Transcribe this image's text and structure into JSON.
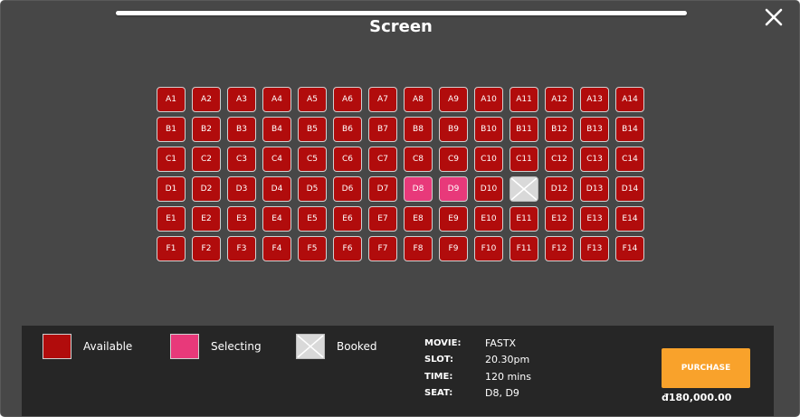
{
  "modal": {
    "screen_label": "Screen"
  },
  "seat_rows": [
    {
      "row": "A",
      "seats": [
        {
          "label": "A1",
          "status": "available"
        },
        {
          "label": "A2",
          "status": "available"
        },
        {
          "label": "A3",
          "status": "available"
        },
        {
          "label": "A4",
          "status": "available"
        },
        {
          "label": "A5",
          "status": "available"
        },
        {
          "label": "A6",
          "status": "available"
        },
        {
          "label": "A7",
          "status": "available"
        },
        {
          "label": "A8",
          "status": "available"
        },
        {
          "label": "A9",
          "status": "available"
        },
        {
          "label": "A10",
          "status": "available"
        },
        {
          "label": "A11",
          "status": "available"
        },
        {
          "label": "A12",
          "status": "available"
        },
        {
          "label": "A13",
          "status": "available"
        },
        {
          "label": "A14",
          "status": "available"
        }
      ]
    },
    {
      "row": "B",
      "seats": [
        {
          "label": "B1",
          "status": "available"
        },
        {
          "label": "B2",
          "status": "available"
        },
        {
          "label": "B3",
          "status": "available"
        },
        {
          "label": "B4",
          "status": "available"
        },
        {
          "label": "B5",
          "status": "available"
        },
        {
          "label": "B6",
          "status": "available"
        },
        {
          "label": "B7",
          "status": "available"
        },
        {
          "label": "B8",
          "status": "available"
        },
        {
          "label": "B9",
          "status": "available"
        },
        {
          "label": "B10",
          "status": "available"
        },
        {
          "label": "B11",
          "status": "available"
        },
        {
          "label": "B12",
          "status": "available"
        },
        {
          "label": "B13",
          "status": "available"
        },
        {
          "label": "B14",
          "status": "available"
        }
      ]
    },
    {
      "row": "C",
      "seats": [
        {
          "label": "C1",
          "status": "available"
        },
        {
          "label": "C2",
          "status": "available"
        },
        {
          "label": "C3",
          "status": "available"
        },
        {
          "label": "C4",
          "status": "available"
        },
        {
          "label": "C5",
          "status": "available"
        },
        {
          "label": "C6",
          "status": "available"
        },
        {
          "label": "C7",
          "status": "available"
        },
        {
          "label": "C8",
          "status": "available"
        },
        {
          "label": "C9",
          "status": "available"
        },
        {
          "label": "C10",
          "status": "available"
        },
        {
          "label": "C11",
          "status": "available"
        },
        {
          "label": "C12",
          "status": "available"
        },
        {
          "label": "C13",
          "status": "available"
        },
        {
          "label": "C14",
          "status": "available"
        }
      ]
    },
    {
      "row": "D",
      "seats": [
        {
          "label": "D1",
          "status": "available"
        },
        {
          "label": "D2",
          "status": "available"
        },
        {
          "label": "D3",
          "status": "available"
        },
        {
          "label": "D4",
          "status": "available"
        },
        {
          "label": "D5",
          "status": "available"
        },
        {
          "label": "D6",
          "status": "available"
        },
        {
          "label": "D7",
          "status": "available"
        },
        {
          "label": "D8",
          "status": "selecting"
        },
        {
          "label": "D9",
          "status": "selecting"
        },
        {
          "label": "D10",
          "status": "available"
        },
        {
          "label": "",
          "status": "booked"
        },
        {
          "label": "D12",
          "status": "available"
        },
        {
          "label": "D13",
          "status": "available"
        },
        {
          "label": "D14",
          "status": "available"
        }
      ]
    },
    {
      "row": "E",
      "seats": [
        {
          "label": "E1",
          "status": "available"
        },
        {
          "label": "E2",
          "status": "available"
        },
        {
          "label": "E3",
          "status": "available"
        },
        {
          "label": "E4",
          "status": "available"
        },
        {
          "label": "E5",
          "status": "available"
        },
        {
          "label": "E6",
          "status": "available"
        },
        {
          "label": "E7",
          "status": "available"
        },
        {
          "label": "E8",
          "status": "available"
        },
        {
          "label": "E9",
          "status": "available"
        },
        {
          "label": "E10",
          "status": "available"
        },
        {
          "label": "E11",
          "status": "available"
        },
        {
          "label": "E12",
          "status": "available"
        },
        {
          "label": "E13",
          "status": "available"
        },
        {
          "label": "E14",
          "status": "available"
        }
      ]
    },
    {
      "row": "F",
      "seats": [
        {
          "label": "F1",
          "status": "available"
        },
        {
          "label": "F2",
          "status": "available"
        },
        {
          "label": "F3",
          "status": "available"
        },
        {
          "label": "F4",
          "status": "available"
        },
        {
          "label": "F5",
          "status": "available"
        },
        {
          "label": "F6",
          "status": "available"
        },
        {
          "label": "F7",
          "status": "available"
        },
        {
          "label": "F8",
          "status": "available"
        },
        {
          "label": "F9",
          "status": "available"
        },
        {
          "label": "F10",
          "status": "available"
        },
        {
          "label": "F11",
          "status": "available"
        },
        {
          "label": "F12",
          "status": "available"
        },
        {
          "label": "F13",
          "status": "available"
        },
        {
          "label": "F14",
          "status": "available"
        }
      ]
    }
  ],
  "legend": {
    "available": "Available",
    "selecting": "Selecting",
    "booked": "Booked"
  },
  "booking": {
    "movie_key": "MOVIE:",
    "movie": "FASTX",
    "slot_key": "SLOT:",
    "slot": "20.30pm",
    "time_key": "TIME:",
    "time": "120 mins",
    "seat_key": "SEAT:",
    "seat": "D8, D9"
  },
  "purchase": {
    "label": "PURCHASE",
    "price": "đ180,000.00"
  },
  "colors": {
    "modal_bg": "#474747",
    "footer_bg": "#262626",
    "available": "#b10c0c",
    "selecting": "#e8397a",
    "booked": "#d9d9d9",
    "purchase": "#f9a22b"
  },
  "icons": {
    "close": "close-icon",
    "booked": "booked-x-icon"
  }
}
